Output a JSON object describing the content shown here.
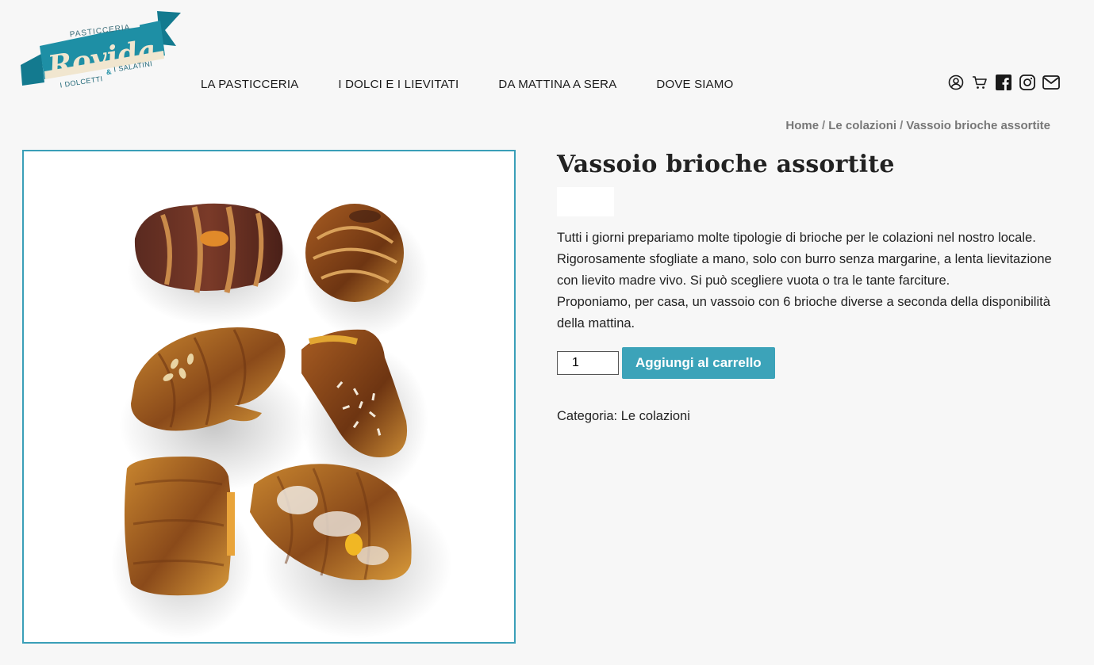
{
  "logo": {
    "top_text": "PASTICCERIA",
    "brand": "Rovida",
    "sub_left": "I DOLCETTI",
    "sub_amp": "&",
    "sub_right": "I SALATINI"
  },
  "nav": {
    "items": [
      {
        "label": "LA PASTICCERIA"
      },
      {
        "label": "I DOLCI E I LIEVITATI"
      },
      {
        "label": "DA MATTINA A SERA"
      },
      {
        "label": "DOVE SIAMO"
      }
    ]
  },
  "header_icons": [
    "user-icon",
    "cart-icon",
    "facebook-icon",
    "instagram-icon",
    "mail-icon"
  ],
  "breadcrumb": {
    "home": "Home",
    "separator": "/",
    "category": "Le colazioni",
    "current": "Vassoio brioche assortite"
  },
  "product": {
    "title": "Vassoio brioche assortite",
    "description": [
      "Tutti i giorni prepariamo molte tipologie di brioche per le colazioni nel nostro locale.",
      "Rigorosamente sfogliate a mano, solo con burro senza margarine, a lenta lievitazione con lievito madre vivo. Si può scegliere vuota o tra le tante farciture.",
      "Proponiamo, per casa, un vassoio con 6 brioche diverse a seconda della disponibilità della mattina."
    ],
    "quantity": "1",
    "add_to_cart": "Aggiungi al carrello",
    "category_label": "Categoria:",
    "category_value": "Le colazioni"
  },
  "colors": {
    "accent": "#3ca3b9",
    "background": "#f7f7f7",
    "logo_ribbon": "#1e8fa5",
    "text": "#222222"
  }
}
